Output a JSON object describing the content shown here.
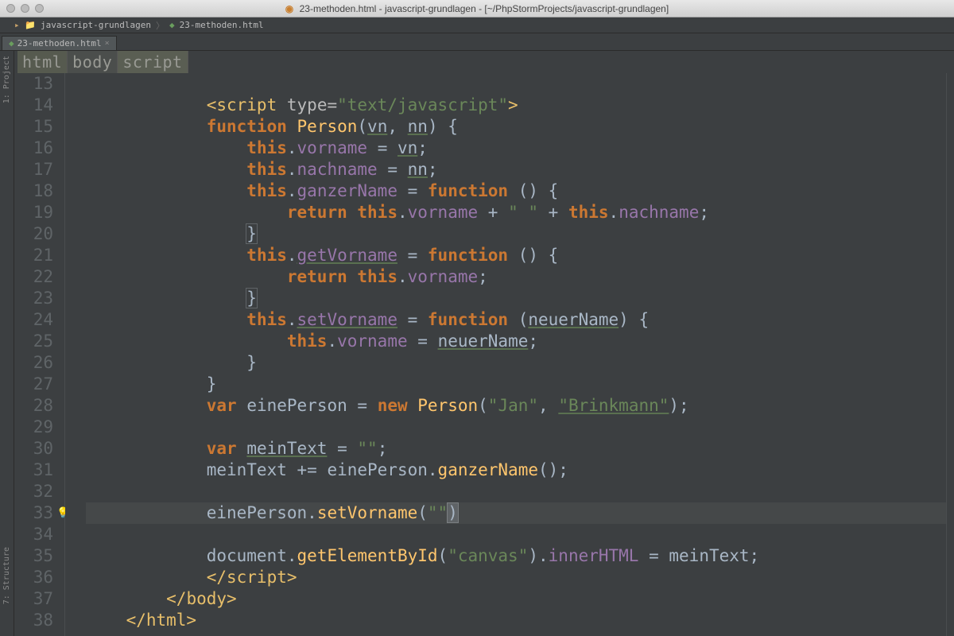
{
  "window": {
    "title": "23-methoden.html - javascript-grundlagen - [~/PhpStormProjects/javascript-grundlagen]"
  },
  "nav": {
    "project": "javascript-grundlagen",
    "file": "23-methoden.html"
  },
  "tab": {
    "label": "23-methoden.html"
  },
  "breadcrumb": [
    "html",
    "body",
    "script"
  ],
  "sidetools": {
    "project": "1: Project",
    "structure": "7: Structure"
  },
  "gutter": {
    "start": 13,
    "end": 38,
    "bulb_line": 33,
    "current_line": 33
  },
  "code": {
    "13": [],
    "14": [
      {
        "t": "tag",
        "v": "<script"
      },
      {
        "t": "op",
        "v": " "
      },
      {
        "t": "attr",
        "v": "type="
      },
      {
        "t": "str",
        "v": "\"text/javascript\""
      },
      {
        "t": "tag",
        "v": ">"
      }
    ],
    "15": [
      {
        "t": "kw",
        "v": "function"
      },
      {
        "t": "op",
        "v": " "
      },
      {
        "t": "fn",
        "v": "Person"
      },
      {
        "t": "op",
        "v": "("
      },
      {
        "t": "param",
        "v": "vn"
      },
      {
        "t": "op",
        "v": ", "
      },
      {
        "t": "param",
        "v": "nn"
      },
      {
        "t": "op",
        "v": ") {"
      }
    ],
    "16": [
      {
        "t": "this",
        "v": "this"
      },
      {
        "t": "op",
        "v": "."
      },
      {
        "t": "prop",
        "v": "vorname"
      },
      {
        "t": "op",
        "v": " = "
      },
      {
        "t": "param",
        "v": "vn"
      },
      {
        "t": "op",
        "v": ";"
      }
    ],
    "17": [
      {
        "t": "this",
        "v": "this"
      },
      {
        "t": "op",
        "v": "."
      },
      {
        "t": "prop",
        "v": "nachname"
      },
      {
        "t": "op",
        "v": " = "
      },
      {
        "t": "param",
        "v": "nn"
      },
      {
        "t": "op",
        "v": ";"
      }
    ],
    "18": [
      {
        "t": "this",
        "v": "this"
      },
      {
        "t": "op",
        "v": "."
      },
      {
        "t": "prop",
        "v": "ganzerName"
      },
      {
        "t": "op",
        "v": " = "
      },
      {
        "t": "kw",
        "v": "function"
      },
      {
        "t": "op",
        "v": " () {"
      }
    ],
    "19": [
      {
        "t": "kw",
        "v": "return"
      },
      {
        "t": "op",
        "v": " "
      },
      {
        "t": "this",
        "v": "this"
      },
      {
        "t": "op",
        "v": "."
      },
      {
        "t": "prop",
        "v": "vorname"
      },
      {
        "t": "op",
        "v": " + "
      },
      {
        "t": "str",
        "v": "\" \""
      },
      {
        "t": "op",
        "v": " + "
      },
      {
        "t": "this",
        "v": "this"
      },
      {
        "t": "op",
        "v": "."
      },
      {
        "t": "prop",
        "v": "nachname"
      },
      {
        "t": "op",
        "v": ";"
      }
    ],
    "20": [
      {
        "t": "brace",
        "v": "}"
      }
    ],
    "21": [
      {
        "t": "this",
        "v": "this"
      },
      {
        "t": "op",
        "v": "."
      },
      {
        "t": "prop underline",
        "v": "getVorname"
      },
      {
        "t": "op",
        "v": " = "
      },
      {
        "t": "kw",
        "v": "function"
      },
      {
        "t": "op",
        "v": " () {"
      }
    ],
    "22": [
      {
        "t": "kw",
        "v": "return"
      },
      {
        "t": "op",
        "v": " "
      },
      {
        "t": "this",
        "v": "this"
      },
      {
        "t": "op",
        "v": "."
      },
      {
        "t": "prop",
        "v": "vorname"
      },
      {
        "t": "op",
        "v": ";"
      }
    ],
    "23": [
      {
        "t": "brace",
        "v": "}"
      }
    ],
    "24": [
      {
        "t": "this",
        "v": "this"
      },
      {
        "t": "op",
        "v": "."
      },
      {
        "t": "prop underline",
        "v": "setVorname"
      },
      {
        "t": "op",
        "v": " = "
      },
      {
        "t": "kw",
        "v": "function"
      },
      {
        "t": "op",
        "v": " ("
      },
      {
        "t": "param",
        "v": "neuerName"
      },
      {
        "t": "op",
        "v": ") {"
      }
    ],
    "25": [
      {
        "t": "this",
        "v": "this"
      },
      {
        "t": "op",
        "v": "."
      },
      {
        "t": "prop",
        "v": "vorname"
      },
      {
        "t": "op",
        "v": " = "
      },
      {
        "t": "param",
        "v": "neuerName"
      },
      {
        "t": "op",
        "v": ";"
      }
    ],
    "26": [
      {
        "t": "op",
        "v": "}"
      }
    ],
    "27": [
      {
        "t": "op",
        "v": "}"
      }
    ],
    "28": [
      {
        "t": "kw",
        "v": "var"
      },
      {
        "t": "op",
        "v": " "
      },
      {
        "t": "id",
        "v": "einePerson"
      },
      {
        "t": "op",
        "v": " = "
      },
      {
        "t": "kw",
        "v": "new"
      },
      {
        "t": "op",
        "v": " "
      },
      {
        "t": "fn",
        "v": "Person"
      },
      {
        "t": "op",
        "v": "("
      },
      {
        "t": "str",
        "v": "\"Jan\""
      },
      {
        "t": "op",
        "v": ", "
      },
      {
        "t": "str underline",
        "v": "\"Brinkmann\""
      },
      {
        "t": "op",
        "v": ");"
      }
    ],
    "29": [],
    "30": [
      {
        "t": "kw",
        "v": "var"
      },
      {
        "t": "op",
        "v": " "
      },
      {
        "t": "id underline",
        "v": "meinText"
      },
      {
        "t": "op",
        "v": " = "
      },
      {
        "t": "str",
        "v": "\"\""
      },
      {
        "t": "op",
        "v": ";"
      }
    ],
    "31": [
      {
        "t": "id",
        "v": "meinText"
      },
      {
        "t": "op",
        "v": " += "
      },
      {
        "t": "id",
        "v": "einePerson"
      },
      {
        "t": "op",
        "v": "."
      },
      {
        "t": "fn",
        "v": "ganzerName"
      },
      {
        "t": "op",
        "v": "();"
      }
    ],
    "32": [],
    "33": [
      {
        "t": "id",
        "v": "einePerson"
      },
      {
        "t": "op",
        "v": "."
      },
      {
        "t": "fn",
        "v": "setVorname"
      },
      {
        "t": "op",
        "v": "("
      },
      {
        "t": "str",
        "v": "\"\""
      },
      {
        "t": "caret",
        "v": ")"
      }
    ],
    "34": [],
    "35": [
      {
        "t": "id",
        "v": "document"
      },
      {
        "t": "op",
        "v": "."
      },
      {
        "t": "fn",
        "v": "getElementById"
      },
      {
        "t": "op",
        "v": "("
      },
      {
        "t": "str",
        "v": "\"canvas\""
      },
      {
        "t": "op",
        "v": ")."
      },
      {
        "t": "prop",
        "v": "innerHTML"
      },
      {
        "t": "op",
        "v": " = "
      },
      {
        "t": "id",
        "v": "meinText"
      },
      {
        "t": "op",
        "v": ";"
      }
    ],
    "36": [
      {
        "t": "tag",
        "v": "</script>"
      }
    ],
    "37": [
      {
        "t": "tag",
        "v": "</body>"
      }
    ],
    "38": [
      {
        "t": "tag",
        "v": "</html>"
      }
    ]
  },
  "indent": {
    "13": 0,
    "14": 12,
    "15": 12,
    "16": 16,
    "17": 16,
    "18": 16,
    "19": 20,
    "20": 16,
    "21": 16,
    "22": 20,
    "23": 16,
    "24": 16,
    "25": 20,
    "26": 16,
    "27": 12,
    "28": 12,
    "29": 0,
    "30": 12,
    "31": 12,
    "32": 0,
    "33": 12,
    "34": 0,
    "35": 12,
    "36": 12,
    "37": 8,
    "38": 4
  }
}
